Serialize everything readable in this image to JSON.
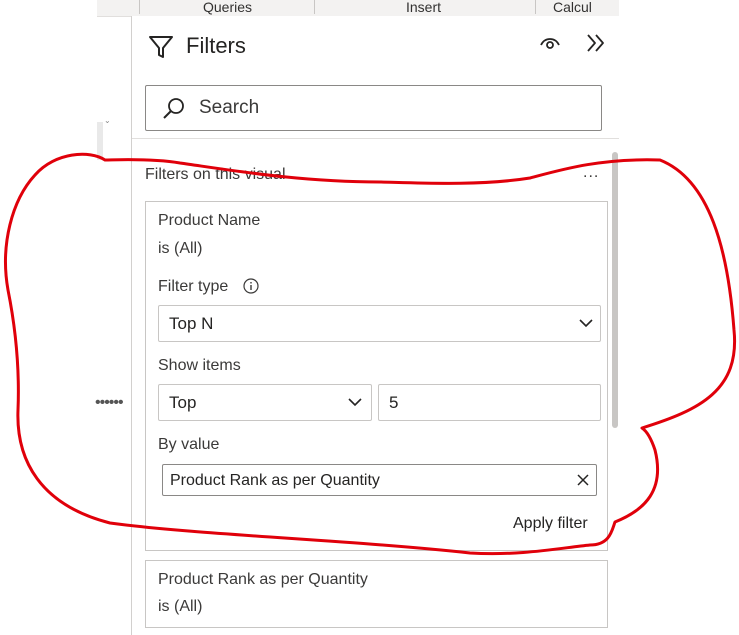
{
  "ribbon": {
    "tabs": [
      "Queries",
      "Insert",
      "Calcul"
    ]
  },
  "pane": {
    "title": "Filters",
    "search_placeholder": "Search",
    "section_title": "Filters on this visual",
    "more_label": "...",
    "filter_cards": [
      {
        "field": "Product Name",
        "state": "is (All)",
        "filter_type_label": "Filter type",
        "filter_type_value": "Top N",
        "show_items_label": "Show items",
        "show_items_direction": "Top",
        "show_items_count": "5",
        "by_value_label": "By value",
        "by_value_field": "Product Rank as per Quantity",
        "apply_label": "Apply filter"
      },
      {
        "field": "Product Rank as per Quantity",
        "state": "is (All)"
      }
    ]
  },
  "colors": {
    "annotation_red": "#e0000a",
    "border": "#c8c6c4",
    "text": "#252423"
  },
  "icons": [
    "funnel-icon",
    "eye-icon",
    "collapse-pane-icon",
    "search-icon",
    "info-icon",
    "chevron-down-icon",
    "clear-icon"
  ]
}
